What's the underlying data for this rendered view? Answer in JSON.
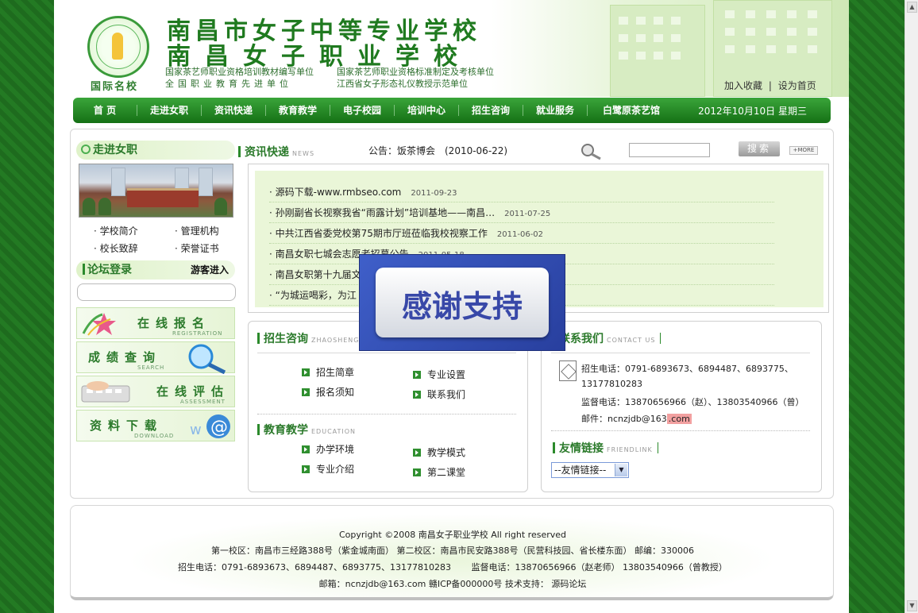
{
  "header": {
    "logo_text": "国际名校",
    "title_line1": "南昌市女子中等专业学校",
    "title_line2": "南昌女子职业学校",
    "sub1a": "国家茶艺师职业资格培训教材编写单位",
    "sub1b": "国家茶艺师职业资格标准制定及考核单位",
    "sub2a": "全国职业教育先进单位",
    "sub2b": "江西省女子形态礼仪教授示范单位",
    "add_favorite": "加入收藏",
    "sep": "|",
    "set_home": "设为首页"
  },
  "nav": {
    "items": [
      "首 页",
      "走进女职",
      "资讯快递",
      "教育教学",
      "电子校园",
      "培训中心",
      "招生咨询",
      "就业服务",
      "白鹭原茶艺馆"
    ],
    "date": "2012年10月10日 星期三"
  },
  "left": {
    "about_title": "走进女职",
    "links": [
      "学校简介",
      "管理机构",
      "校长致辞",
      "荣誉证书"
    ],
    "forum_title": "论坛登录",
    "guest": "游客进入",
    "banners": [
      {
        "title": "在线报名",
        "en": "REGISTRATION"
      },
      {
        "title": "成绩查询",
        "en": "SEARCH"
      },
      {
        "title": "在线评估",
        "en": "ASSESSMENT"
      },
      {
        "title": "资料下载",
        "en": "DOWNLOAD"
      }
    ]
  },
  "news": {
    "title": "资讯快递",
    "en": "NEWS",
    "notice": "公告：饭茶博会　(2010-06-22)",
    "search_button": "搜索",
    "more": "+MORE",
    "items": [
      {
        "text": "· 源码下载-www.rmbseo.com",
        "date": "2011-09-23"
      },
      {
        "text": "· 孙刚副省长视察我省“雨露计划”培训基地——南昌…",
        "date": "2011-07-25"
      },
      {
        "text": "· 中共江西省委党校第75期市厅班莅临我校视察工作",
        "date": "2011-06-02"
      },
      {
        "text": "· 南昌女职七城会志愿者招募公告",
        "date": "2011-05-18"
      },
      {
        "text": "· 南昌女职第十九届文",
        "date": ""
      },
      {
        "text": "· “为城运喝彩，为江",
        "date": ""
      }
    ]
  },
  "popup": {
    "text": "感谢支持"
  },
  "admissions": {
    "title": "招生咨询",
    "en": "ZHAOSHENG",
    "links": [
      "招生简章",
      "专业设置",
      "报名须知",
      "联系我们"
    ]
  },
  "education": {
    "title": "教育教学",
    "en": "EDUCATION",
    "links": [
      "办学环境",
      "教学模式",
      "专业介绍",
      "第二课堂"
    ]
  },
  "contact": {
    "title": "联系我们",
    "en": "CONTACT US",
    "phone_line1": "招生电话：0791-6893673、6894487、6893775、",
    "phone_line2": "13177810283",
    "supervise": "监督电话：13870656966（赵）、13803540966（曾）",
    "email_prefix": "邮件：ncnzjdb@163",
    "email_suffix": ".com"
  },
  "friendlinks": {
    "title": "友情链接",
    "en": "FRIENDLINK",
    "select_value": "--友情链接--"
  },
  "footer": {
    "line1": "Copyright ©2008 南昌女子职业学校 All right reserved",
    "line2": "第一校区：南昌市三经路388号（紫金城南面） 第二校区：南昌市民安路388号（民营科技园、省长楼东面） 邮编：330006",
    "line3": "招生电话：0791-6893673、6894487、6893775、13177810283　　 监督电话：13870656966（赵老师） 13803540966（曾教授）",
    "line4": "邮箱：ncnzjdb@163.com 赣ICP备000000号 技术支持： 源码论坛"
  },
  "colors": {
    "brand_green": "#1f7a1f",
    "nav_green": "#157015",
    "news_bg": "#eaf6d8",
    "popup_blue": "#3f5fc9"
  }
}
